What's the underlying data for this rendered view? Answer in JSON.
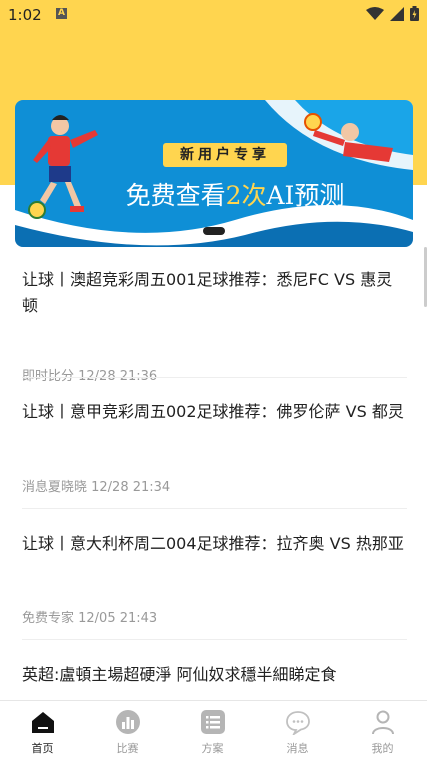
{
  "status": {
    "time": "1:02",
    "notif": "A"
  },
  "banner": {
    "badge": "新用户专享",
    "text_pre": "免费查看",
    "text_num": "2次",
    "text_post": "AI预测"
  },
  "articles": [
    {
      "title": "让球丨澳超竞彩周五001足球推荐：悉尼FC VS 惠灵顿",
      "meta": "即时比分 12/28 21:36"
    },
    {
      "title": "让球丨意甲竞彩周五002足球推荐：佛罗伦萨 VS 都灵",
      "meta": "消息夏晓晓 12/28 21:34"
    },
    {
      "title": "让球丨意大利杯周二004足球推荐：拉齐奥 VS 热那亚",
      "meta": "免费专家 12/05 21:43"
    },
    {
      "title": "英超:盧頓主場超硬淨 阿仙奴求穩半細睇定食"
    }
  ],
  "tabs": [
    {
      "label": "首页",
      "icon": "home-icon",
      "active": true
    },
    {
      "label": "比赛",
      "icon": "chart-icon"
    },
    {
      "label": "方案",
      "icon": "list-icon"
    },
    {
      "label": "消息",
      "icon": "message-icon"
    },
    {
      "label": "我的",
      "icon": "user-icon"
    }
  ],
  "colors": {
    "accent": "#ffd54f",
    "banner": "#0f8fd6",
    "text": "#222222",
    "muted": "#999999"
  }
}
